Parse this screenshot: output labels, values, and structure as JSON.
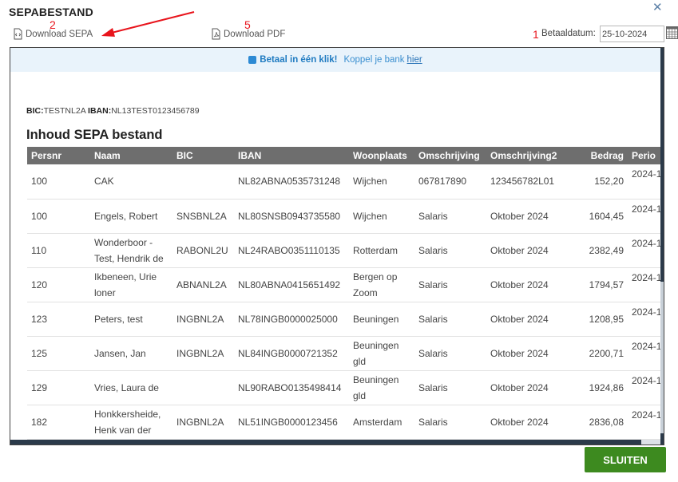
{
  "dialog": {
    "title": "SEPABESTAND",
    "close_glyph": "✕"
  },
  "toolbar": {
    "download_sepa_label": "Download SEPA",
    "download_sepa_icon": "xml-file-icon",
    "download_pdf_label": "Download PDF",
    "download_pdf_icon": "pdf-file-icon",
    "betaaldatum_label": "Betaaldatum:",
    "betaaldatum_value": "25-10-2024"
  },
  "annotations": {
    "a2": "2",
    "a5": "5",
    "a1": "1",
    "color": "#e8141c"
  },
  "banner": {
    "bold_text": "Betaal in één klik!",
    "text": "Koppel je bank",
    "link": "hier"
  },
  "document": {
    "bic_label": "BIC:",
    "bic_value": "TESTNL2A",
    "iban_label": "IBAN:",
    "iban_value": "NL13TEST0123456789",
    "title": "Inhoud SEPA bestand"
  },
  "table": {
    "headers": [
      "Persnr",
      "Naam",
      "BIC",
      "IBAN",
      "Woonplaats",
      "Omschrijving",
      "Omschrijving2",
      "Bedrag",
      "Perio"
    ],
    "rows": [
      [
        "100",
        "CAK",
        "",
        "NL82ABNA0535731248",
        "Wijchen",
        "067817890",
        "123456782L01",
        "152,20",
        "2024-1"
      ],
      [
        "100",
        "Engels, Robert",
        "SNSBNL2A",
        "NL80SNSB0943735580",
        "Wijchen",
        "Salaris",
        "Oktober 2024",
        "1604,45",
        "2024-1"
      ],
      [
        "110",
        "Wonderboor - Test, Hendrik de",
        "RABONL2U",
        "NL24RABO0351110135",
        "Rotterdam",
        "Salaris",
        "Oktober 2024",
        "2382,49",
        "2024-1"
      ],
      [
        "120",
        "Ikbeneen, Urie loner",
        "ABNANL2A",
        "NL80ABNA0415651492",
        "Bergen op Zoom",
        "Salaris",
        "Oktober 2024",
        "1794,57",
        "2024-1"
      ],
      [
        "123",
        "Peters, test",
        "INGBNL2A",
        "NL78INGB0000025000",
        "Beuningen",
        "Salaris",
        "Oktober 2024",
        "1208,95",
        "2024-1"
      ],
      [
        "125",
        "Jansen, Jan",
        "INGBNL2A",
        "NL84INGB0000721352",
        "Beuningen gld",
        "Salaris",
        "Oktober 2024",
        "2200,71",
        "2024-1"
      ],
      [
        "129",
        "Vries, Laura de",
        "",
        "NL90RABO0135498414",
        "Beuningen gld",
        "Salaris",
        "Oktober 2024",
        "1924,86",
        "2024-1"
      ],
      [
        "182",
        "Honkkersheide, Henk van der",
        "INGBNL2A",
        "NL51INGB0000123456",
        "Amsterdam",
        "Salaris",
        "Oktober 2024",
        "2836,08",
        "2024-1"
      ]
    ]
  },
  "footer": {
    "close_label": "SLUITEN"
  },
  "colors": {
    "header_bg": "#6e6e6e",
    "close_button": "#3d8a1f",
    "banner_bg": "#e9f3fb",
    "link": "#2a74b8"
  }
}
